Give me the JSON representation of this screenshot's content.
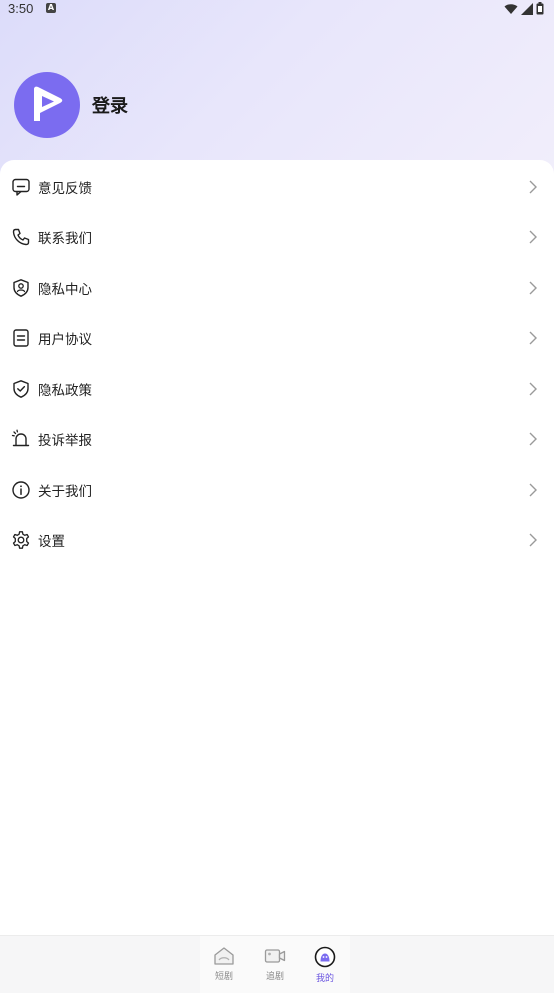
{
  "status_bar": {
    "time": "3:50",
    "notification_icon": "a-icon",
    "right_icons": [
      "wifi-icon",
      "signal-icon",
      "battery-icon"
    ]
  },
  "profile": {
    "avatar_icon": "play-logo-icon",
    "login_label": "登录"
  },
  "menu": [
    {
      "label": "意见反馈",
      "icon": "feedback-icon"
    },
    {
      "label": "联系我们",
      "icon": "phone-icon"
    },
    {
      "label": "隐私中心",
      "icon": "privacy-shield-user-icon"
    },
    {
      "label": "用户协议",
      "icon": "document-icon"
    },
    {
      "label": "隐私政策",
      "icon": "shield-check-icon"
    },
    {
      "label": "投诉举报",
      "icon": "alarm-bell-icon"
    },
    {
      "label": "关于我们",
      "icon": "info-icon"
    },
    {
      "label": "设置",
      "icon": "gear-icon"
    }
  ],
  "bottom_nav": {
    "items": [
      {
        "label": "短剧",
        "icon": "home-icon",
        "active": false
      },
      {
        "label": "追剧",
        "icon": "video-icon",
        "active": false
      },
      {
        "label": "我的",
        "icon": "profile-face-icon",
        "active": true
      }
    ]
  },
  "colors": {
    "accent": "#6a55e0",
    "avatar_bg": "#7b6cf0",
    "header_gradient_start": "#dcdcfa",
    "header_gradient_end": "#f1eefb"
  }
}
